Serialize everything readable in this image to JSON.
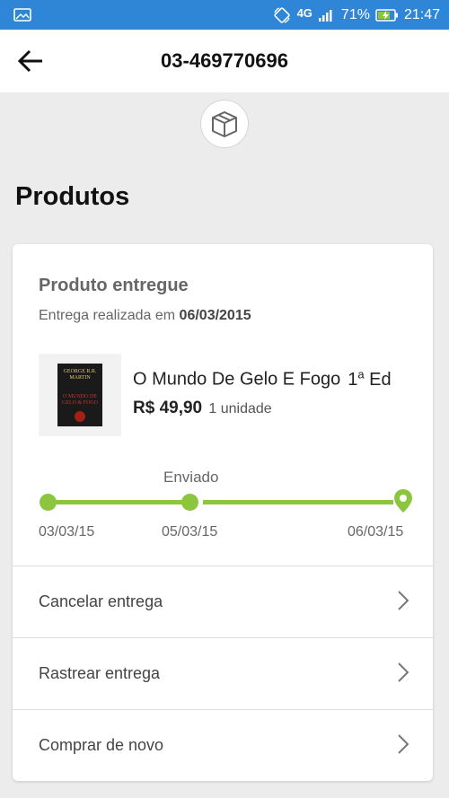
{
  "status_bar": {
    "network": "4G",
    "battery": "71%",
    "time": "21:47",
    "icons": [
      "image-icon",
      "rotate-icon",
      "signal-icon",
      "battery-charging-icon"
    ]
  },
  "header": {
    "title": "03-469770696",
    "back_icon": "arrow-left-icon"
  },
  "hero_icon": "box-icon",
  "section": {
    "title": "Produtos"
  },
  "delivery": {
    "status_title": "Produto entregue",
    "subtitle_prefix": "Entrega realizada em",
    "date": "06/03/2015"
  },
  "product": {
    "name": "O Mundo De Gelo E Fogo",
    "edition_num": "1",
    "edition_sup": "a",
    "edition_suffix": "Ed",
    "price": "R$ 49,90",
    "quantity": "1 unidade",
    "cover": {
      "author_line1": "GEORGE R.R.",
      "author_line2": "MARTIN",
      "title_line1": "O MUNDO DE",
      "title_line2": "GELO & FOGO"
    }
  },
  "timeline": {
    "current_label": "Enviado",
    "progress": 1.0,
    "stops": [
      {
        "date": "03/03/15",
        "type": "dot"
      },
      {
        "date": "05/03/15",
        "type": "dot"
      },
      {
        "date": "06/03/15",
        "type": "pin"
      }
    ],
    "color": "#8cc63f"
  },
  "actions": [
    {
      "label": "Cancelar entrega",
      "icon": "chevron-right-icon"
    },
    {
      "label": "Rastrear entrega",
      "icon": "chevron-right-icon"
    },
    {
      "label": "Comprar de novo",
      "icon": "chevron-right-icon"
    }
  ],
  "colors": {
    "status_bar": "#2f86d6",
    "accent_green": "#8cc63f",
    "background": "#ececec"
  }
}
